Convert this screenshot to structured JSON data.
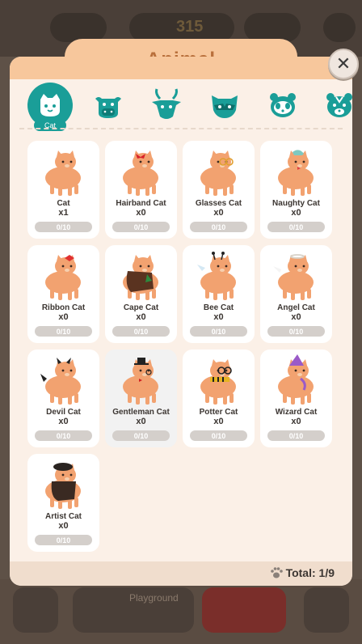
{
  "hud": {
    "currency_amount": "315",
    "playground_label": "Playground"
  },
  "modal": {
    "title": "Animal",
    "close_glyph": "✕",
    "total_label": "Total: 1/9"
  },
  "tabs": [
    {
      "label": "Cat",
      "icon": "cat-icon",
      "active": true
    },
    {
      "label": "",
      "icon": "cow-icon",
      "active": false
    },
    {
      "label": "",
      "icon": "antelope-icon",
      "active": false
    },
    {
      "label": "",
      "icon": "raccoon-icon",
      "active": false
    },
    {
      "label": "",
      "icon": "panda-icon",
      "active": false
    },
    {
      "label": "",
      "icon": "tiger-icon",
      "active": false
    }
  ],
  "cats": [
    {
      "name": "Cat",
      "count": "x1",
      "progress": "0/10",
      "accessory": "none"
    },
    {
      "name": "Hairband Cat",
      "count": "x0",
      "progress": "0/10",
      "accessory": "hairband"
    },
    {
      "name": "Glasses Cat",
      "count": "x0",
      "progress": "0/10",
      "accessory": "glasses"
    },
    {
      "name": "Naughty Cat",
      "count": "x0",
      "progress": "0/10",
      "accessory": "naughty"
    },
    {
      "name": "Ribbon Cat",
      "count": "x0",
      "progress": "0/10",
      "accessory": "ribbon"
    },
    {
      "name": "Cape Cat",
      "count": "x0",
      "progress": "0/10",
      "accessory": "cape"
    },
    {
      "name": "Bee Cat",
      "count": "x0",
      "progress": "0/10",
      "accessory": "bee"
    },
    {
      "name": "Angel Cat",
      "count": "x0",
      "progress": "0/10",
      "accessory": "angel"
    },
    {
      "name": "Devil Cat",
      "count": "x0",
      "progress": "0/10",
      "accessory": "devil"
    },
    {
      "name": "Gentleman Cat",
      "count": "x0",
      "progress": "0/10",
      "accessory": "gentleman"
    },
    {
      "name": "Potter Cat",
      "count": "x0",
      "progress": "0/10",
      "accessory": "potter"
    },
    {
      "name": "Wizard Cat",
      "count": "x0",
      "progress": "0/10",
      "accessory": "wizard"
    },
    {
      "name": "Artist Cat",
      "count": "x0",
      "progress": "0/10",
      "accessory": "artist"
    }
  ],
  "colors": {
    "accent": "#1a9e98",
    "title": "#b9703c",
    "header": "#f7c79c",
    "panel": "#fbf0e7",
    "cat_body": "#f2a270"
  }
}
